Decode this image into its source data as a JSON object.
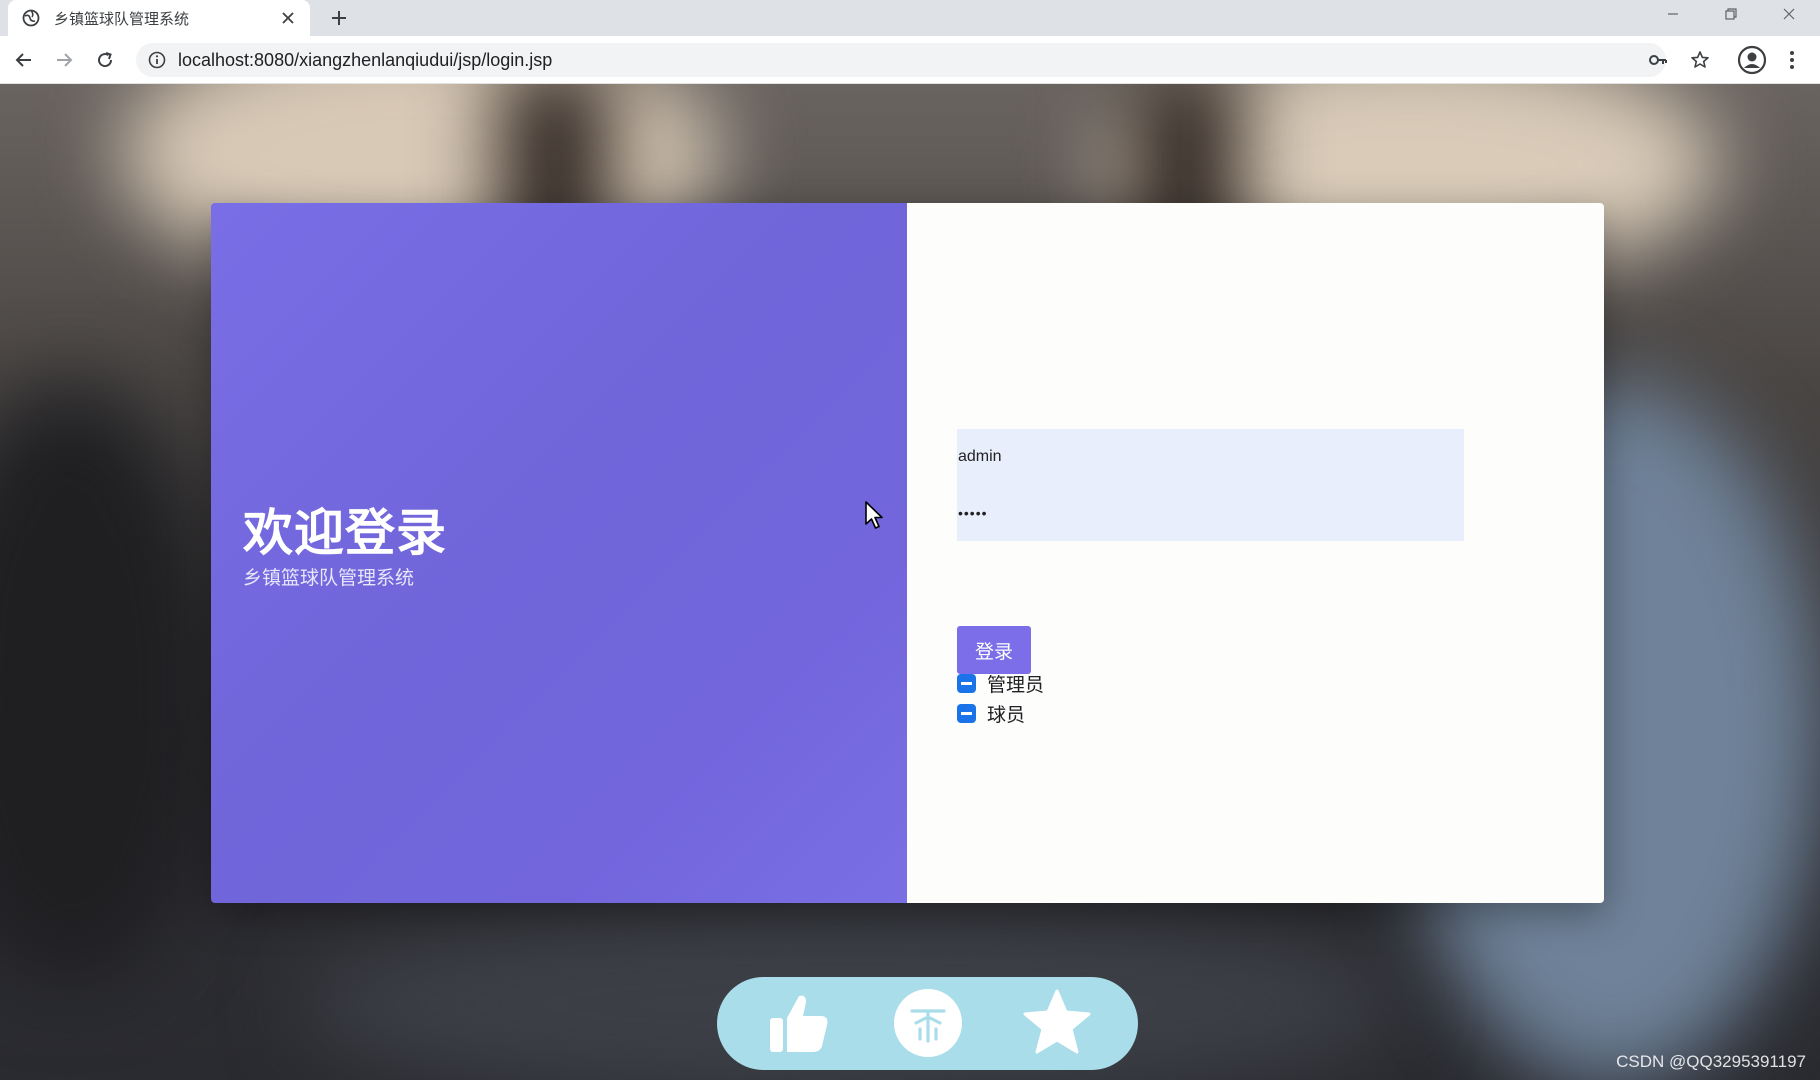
{
  "browser": {
    "tab_title": "乡镇篮球队管理系统",
    "url": "localhost:8080/xiangzhenlanqiudui/jsp/login.jsp"
  },
  "login": {
    "welcome_title": "欢迎登录",
    "welcome_subtitle": "乡镇篮球队管理系统",
    "username_value": "admin",
    "password_value": "•••••",
    "roles": [
      {
        "label": "管理员",
        "checked": true
      },
      {
        "label": "球员",
        "checked": true
      }
    ],
    "submit_label": "登录"
  },
  "actions": {
    "icons": [
      "thumbs-up-icon",
      "coin-icon",
      "star-icon"
    ]
  },
  "watermark": "CSDN @QQ3295391197",
  "colors": {
    "left_panel": "#7468df",
    "login_button": "#7b6ee8",
    "checkbox": "#1a73e8",
    "credential_bg": "#e8eefc",
    "action_pill": "#a9ddea"
  }
}
